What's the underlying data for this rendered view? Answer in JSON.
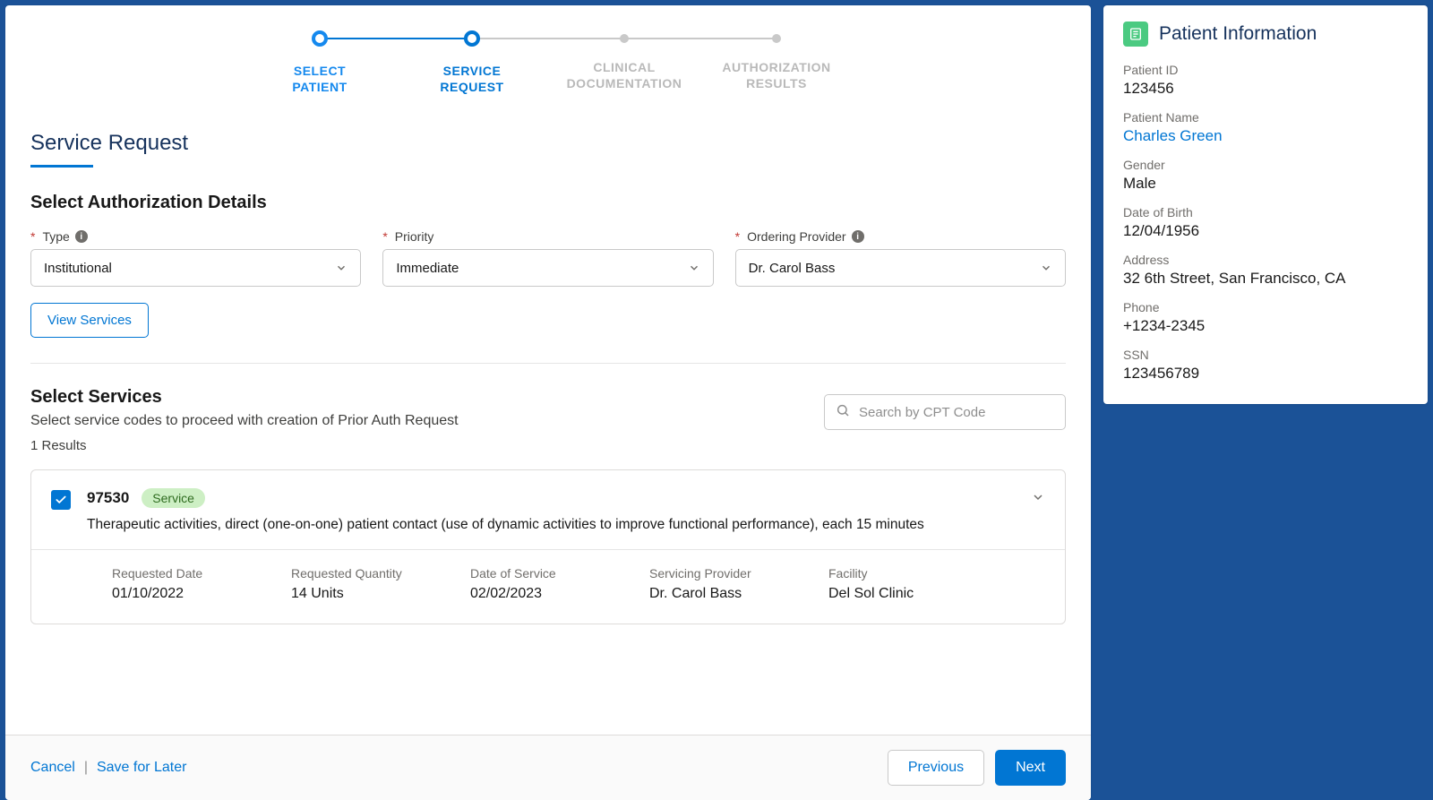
{
  "steps": [
    {
      "label": "SELECT\nPATIENT",
      "state": "done"
    },
    {
      "label": "SERVICE\nREQUEST",
      "state": "active"
    },
    {
      "label": "CLINICAL\nDOCUMENTATION",
      "state": "inactive"
    },
    {
      "label": "AUTHORIZATION\nRESULTS",
      "state": "inactive"
    }
  ],
  "page_title": "Service Request",
  "auth_section_title": "Select Authorization Details",
  "fields": {
    "type": {
      "label": "Type",
      "value": "Institutional",
      "required": true,
      "info": true
    },
    "priority": {
      "label": "Priority",
      "value": "Immediate",
      "required": true,
      "info": false
    },
    "ordering_provider": {
      "label": "Ordering Provider",
      "value": "Dr. Carol Bass",
      "required": true,
      "info": true
    }
  },
  "view_services_btn": "View Services",
  "services": {
    "title": "Select Services",
    "desc": "Select service codes to proceed with creation of Prior Auth Request",
    "search_placeholder": "Search by CPT Code",
    "results_count": "1 Results"
  },
  "service_item": {
    "code": "97530",
    "badge": "Service",
    "desc": "Therapeutic activities, direct (one-on-one) patient contact (use of dynamic activities to improve functional performance), each 15 minutes",
    "details": [
      {
        "label": "Requested Date",
        "value": "01/10/2022"
      },
      {
        "label": "Requested Quantity",
        "value": "14 Units"
      },
      {
        "label": "Date of Service",
        "value": "02/02/2023"
      },
      {
        "label": "Servicing Provider",
        "value": "Dr. Carol Bass"
      },
      {
        "label": "Facility",
        "value": "Del Sol Clinic"
      }
    ]
  },
  "footer": {
    "cancel": "Cancel",
    "save": "Save for Later",
    "previous": "Previous",
    "next": "Next"
  },
  "patient_panel": {
    "title": "Patient Information",
    "fields": [
      {
        "label": "Patient ID",
        "value": "123456",
        "link": false
      },
      {
        "label": "Patient Name",
        "value": "Charles Green",
        "link": true
      },
      {
        "label": "Gender",
        "value": "Male",
        "link": false
      },
      {
        "label": "Date of Birth",
        "value": "12/04/1956",
        "link": false
      },
      {
        "label": "Address",
        "value": "32 6th Street, San Francisco, CA",
        "link": false
      },
      {
        "label": "Phone",
        "value": "+1234-2345",
        "link": false
      },
      {
        "label": "SSN",
        "value": "123456789",
        "link": false
      }
    ]
  }
}
